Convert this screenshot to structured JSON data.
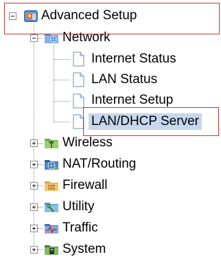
{
  "tree": {
    "root": {
      "label": "Advanced Setup",
      "icon": "advanced-setup-icon",
      "expanded": true,
      "children": [
        {
          "label": "Network",
          "icon": "network-folder-icon",
          "expanded": true,
          "children": [
            {
              "label": "Internet Status",
              "icon": "page-icon"
            },
            {
              "label": "LAN Status",
              "icon": "page-icon"
            },
            {
              "label": "Internet Setup",
              "icon": "page-icon"
            },
            {
              "label": "LAN/DHCP Server",
              "icon": "page-icon",
              "selected": true
            }
          ]
        },
        {
          "label": "Wireless",
          "icon": "wireless-icon",
          "expanded": false
        },
        {
          "label": "NAT/Routing",
          "icon": "nat-routing-icon",
          "expanded": false
        },
        {
          "label": "Firewall",
          "icon": "firewall-icon",
          "expanded": false
        },
        {
          "label": "Utility",
          "icon": "utility-icon",
          "expanded": false
        },
        {
          "label": "Traffic",
          "icon": "traffic-icon",
          "expanded": false
        },
        {
          "label": "System",
          "icon": "system-icon",
          "expanded": false
        }
      ]
    }
  },
  "colors": {
    "selection_background": "#c6d7ee",
    "highlight_border": "#c0392b",
    "connector": "#8a8a8a"
  }
}
